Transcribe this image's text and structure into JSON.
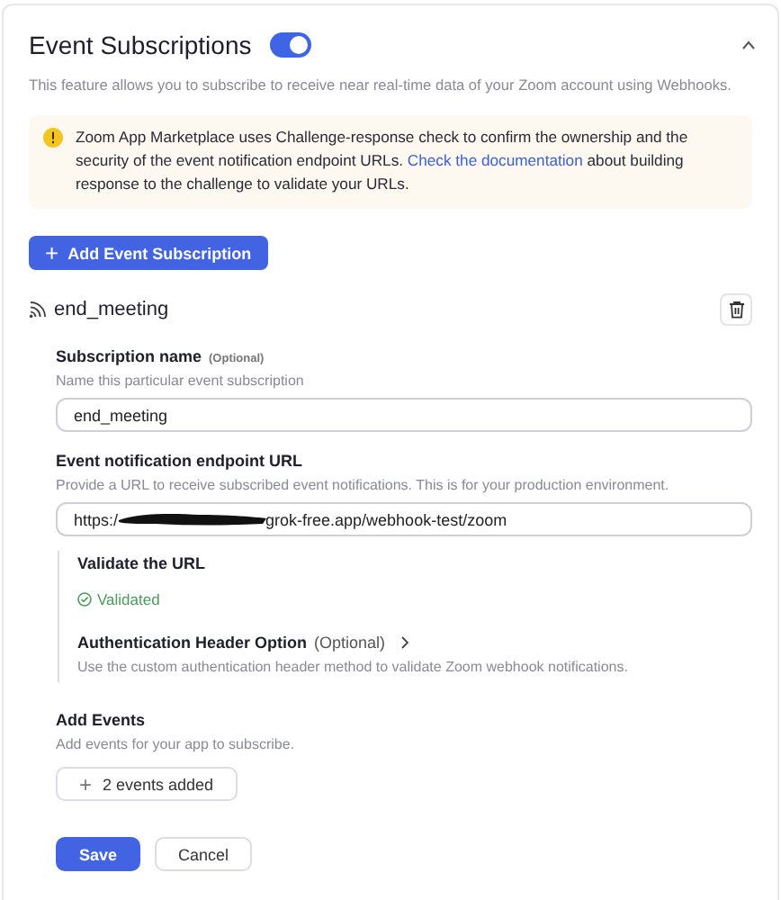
{
  "section": {
    "title": "Event Subscriptions",
    "enabled": true,
    "expanded": true,
    "description": "This feature allows you to subscribe to receive near real-time data of your Zoom account using Webhooks."
  },
  "notice": {
    "text_before": "Zoom App Marketplace uses Challenge-response check to confirm the ownership and the security of the event notification endpoint URLs.",
    "link": "Check the documentation",
    "text_after": "about building response to the challenge to validate your URLs."
  },
  "add_button": {
    "icon": "+",
    "label": "Add Event Subscription"
  },
  "subscription": {
    "name": "end_meeting",
    "name_field": {
      "label": "Subscription name",
      "optional": "(Optional)",
      "hint": "Name this particular event subscription",
      "value": "end_meeting"
    },
    "url_field": {
      "label": "Event notification endpoint URL",
      "hint": "Provide a URL to receive subscribed event notifications. This is for your production environment.",
      "value_start": "https:/",
      "value_end": "grok-free.app/webhook-test/zoom",
      "redacted": true
    },
    "validate": {
      "title": "Validate the URL",
      "validated": true,
      "status": "Validated"
    },
    "auth": {
      "title": "Authentication Header Option",
      "optional": "(Optional)",
      "hint": "Use the custom authentication header method to validate Zoom webhook notifications."
    },
    "events": {
      "title": "Add Events",
      "hint": "Add events for your app to subscribe.",
      "icon": "+",
      "button": "2 events added"
    }
  },
  "actions": [
    {
      "label": "Save",
      "kind": "primary"
    },
    {
      "label": "Cancel",
      "kind": "secondary"
    }
  ]
}
